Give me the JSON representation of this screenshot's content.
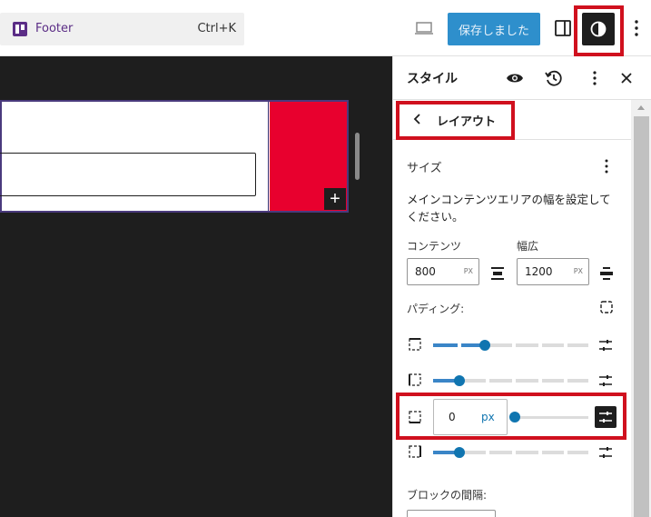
{
  "topbar": {
    "template_label": "Footer",
    "shortcut": "Ctrl+K",
    "save_label": "保存しました"
  },
  "sidebar": {
    "title": "スタイル",
    "back_title": "レイアウト",
    "size_section": "サイズ",
    "description": "メインコンテンツエリアの幅を設定してください。",
    "content_label": "コンテンツ",
    "content_value": "800",
    "content_unit": "PX",
    "wide_label": "幅広",
    "wide_value": "1200",
    "wide_unit": "PX",
    "padding_label": "パディング:",
    "padding_input_value": "0",
    "padding_input_unit": "px",
    "block_gap_label": "ブロックの間隔:"
  },
  "colors": {
    "accent": "#1075b0",
    "save_button": "#2e8fcc",
    "highlight": "#d0101e",
    "block_red": "#e8002e",
    "template_purple": "#5b2d86"
  },
  "icons": [
    "template-icon",
    "desktop-device-icon",
    "sidebar-toggle-icon",
    "styles-contrast-icon",
    "more-vertical-icon",
    "eye-icon",
    "history-icon",
    "close-icon",
    "chevron-left-icon",
    "justify-icon",
    "link-sides-icon",
    "side-icon",
    "adjust-icon",
    "plus-icon"
  ]
}
